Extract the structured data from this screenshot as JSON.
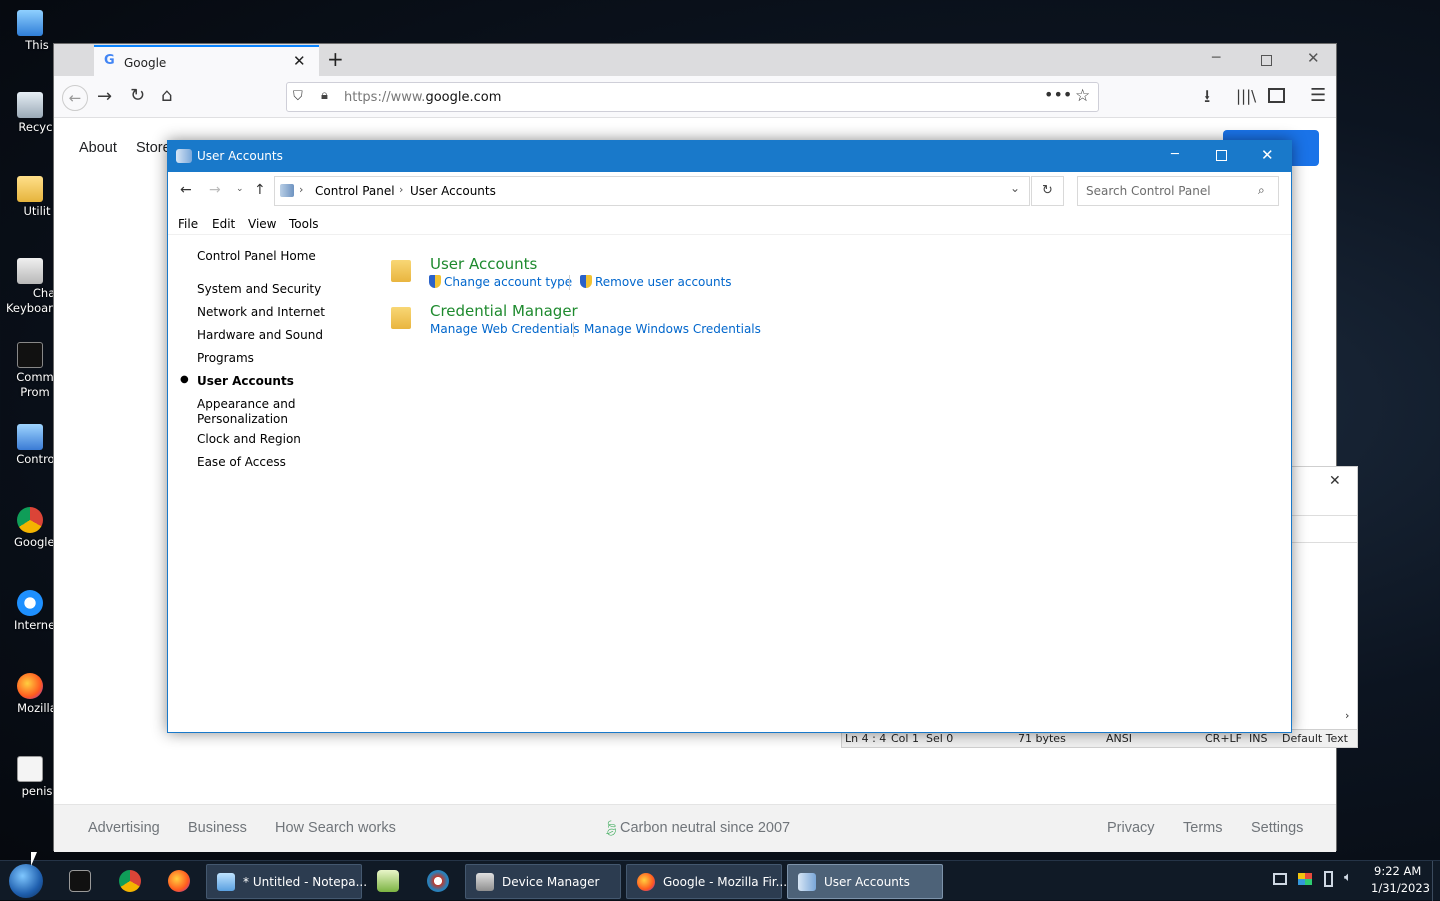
{
  "desktop": {
    "icons": [
      "This",
      "Recycl",
      "Utilit",
      "Char Keyboard",
      "Comm Prom",
      "Control",
      "Google C",
      "Internet E",
      "Mozilla",
      "penis"
    ]
  },
  "firefox": {
    "tab_title": "Google",
    "url_scheme": "https://www.",
    "url_domain": "google.com",
    "page_links": {
      "about": "About",
      "store": "Store"
    },
    "footer": {
      "advertising": "Advertising",
      "business": "Business",
      "how_search_works": "How Search works",
      "carbon": "Carbon neutral since 2007",
      "privacy": "Privacy",
      "terms": "Terms",
      "settings": "Settings"
    }
  },
  "notepad": {
    "status": {
      "ln": "Ln 4 : 4",
      "col": "Col 1",
      "sel": "Sel 0",
      "bytes": "71 bytes",
      "encoding": "ANSI",
      "eol": "CR+LF",
      "ins": "INS",
      "style": "Default Text"
    }
  },
  "control_panel": {
    "window_title": "User Accounts",
    "breadcrumb": [
      "Control Panel",
      "User Accounts"
    ],
    "search_placeholder": "Search Control Panel",
    "menu": [
      "File",
      "Edit",
      "View",
      "Tools"
    ],
    "sidebar": {
      "home": "Control Panel Home",
      "items": [
        "System and Security",
        "Network and Internet",
        "Hardware and Sound",
        "Programs",
        "User Accounts",
        "Appearance and",
        "Personalization",
        "Clock and Region",
        "Ease of Access"
      ]
    },
    "categories": [
      {
        "title": "User Accounts",
        "links": [
          "Change account type",
          "Remove user accounts"
        ]
      },
      {
        "title": "Credential Manager",
        "links": [
          "Manage Web Credentials",
          "Manage Windows Credentials"
        ]
      }
    ]
  },
  "taskbar": {
    "tasks": [
      "* Untitled - Notepa...",
      "Device Manager",
      "Google - Mozilla Fir...",
      "User Accounts"
    ],
    "time": "9:22 AM",
    "date": "1/31/2023"
  }
}
